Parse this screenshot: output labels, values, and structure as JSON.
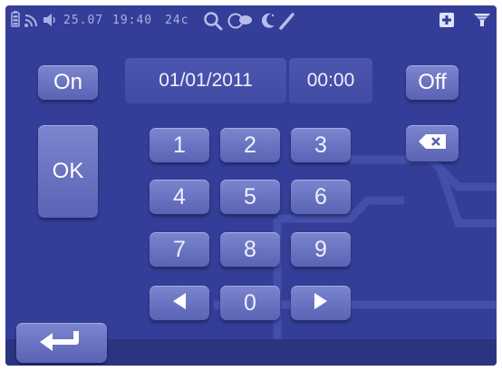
{
  "status_bar": {
    "icons": [
      "battery-icon",
      "signal-icon",
      "speaker-icon",
      "search-icon",
      "chat-bubble-icon",
      "moon-icon",
      "pen-icon",
      "plus-icon",
      "filter-icon"
    ],
    "date": "25.07",
    "time": "19:40",
    "temperature": "24c"
  },
  "controls": {
    "on_label": "On",
    "ok_label": "OK",
    "off_label": "Off"
  },
  "display": {
    "date": "01/01/2011",
    "time": "00:00"
  },
  "keypad": {
    "keys": [
      "1",
      "2",
      "3",
      "4",
      "5",
      "6",
      "7",
      "8",
      "9",
      "0"
    ],
    "left_icon": "arrow-left-icon",
    "right_icon": "arrow-right-icon",
    "backspace_icon": "backspace-icon",
    "enter_icon": "enter-return-icon"
  },
  "colors": {
    "background": "#343e98",
    "button": "#6a73c2",
    "text": "#ffffff"
  }
}
